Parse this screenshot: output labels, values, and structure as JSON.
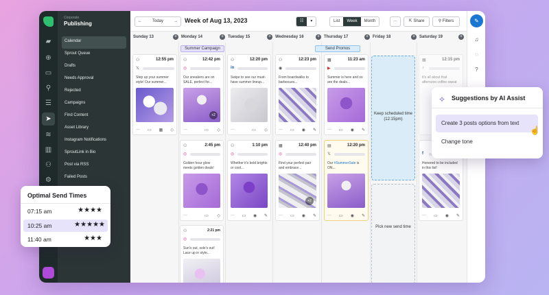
{
  "sidebar": {
    "org": "Corporate",
    "workspace": "Publishing",
    "items": [
      {
        "label": "Calendar",
        "active": true
      },
      {
        "label": "Sprout Queue"
      },
      {
        "label": "Drafts"
      },
      {
        "label": "Needs Approval"
      },
      {
        "label": "Rejected"
      },
      {
        "label": "Campaigns"
      },
      {
        "label": "Find Content"
      },
      {
        "label": "Asset Library"
      },
      {
        "label": "Instagram Notifications"
      },
      {
        "label": "SproutLink in Bio"
      },
      {
        "label": "Post via RSS"
      },
      {
        "label": "Failed Posts"
      }
    ]
  },
  "toolbar": {
    "today": "Today",
    "week_title": "Week of Aug 13, 2023",
    "views": [
      "List",
      "Week",
      "Month"
    ],
    "active_view": "Week",
    "more": "···",
    "share": "Share",
    "filters": "Filters"
  },
  "days": [
    "Sunday 13",
    "Monday 14",
    "Tuesday 15",
    "Wednesday 16",
    "Thursday 17",
    "Friday 18",
    "Saturday 19"
  ],
  "banners": {
    "summer": "Summer Campaign",
    "promos": "Send Promos"
  },
  "cards": {
    "sun1": {
      "time": "12:55 pm",
      "net": "𝕏",
      "text": "Step up your summer style! Our summer..."
    },
    "mon1": {
      "time": "12:42 pm",
      "net": "◎",
      "text": "Our sneakers are on SALE, perfect for...",
      "more": "+2"
    },
    "mon2": {
      "time": "2:45 pm",
      "net": "◎",
      "text": "Golden hour glow meets golden deals!"
    },
    "mon3": {
      "time": "2:21 pm",
      "net": "◎",
      "text": "Sun's out, sole's out! Lace up in style..."
    },
    "tue1": {
      "time": "12:20 pm",
      "net": "in",
      "text": "Swipe to see our must-have summer lineup..."
    },
    "tue2": {
      "time": "1:10 pm",
      "net": "◎",
      "text": "Whether it's bold brights or cool..."
    },
    "wed1": {
      "time": "12:23 pm",
      "net": "◉",
      "text": "From boardwalks to barbecues..."
    },
    "wed2": {
      "time": "12:40 pm",
      "net": "◎",
      "text": "Find your perfect pair and embrace...",
      "more": "+2"
    },
    "thu1": {
      "time": "11:23 am",
      "net": "▶",
      "text": "Summer is here and so are the deals..."
    },
    "thu2": {
      "time": "12:20 pm",
      "net": "𝕏",
      "text_pre": "Our ",
      "hashtag": "#SummerSale",
      "text_post": " is ON..."
    },
    "sat1": {
      "time": "12:15 pm",
      "net": "♪",
      "text": "It's all about that afternoon coffee sweat"
    },
    "sat2": {
      "time": "",
      "net": "f",
      "text": "Honored to be included in this list!"
    }
  },
  "drops": {
    "keep": "Keep scheduled time (12:15pm)",
    "pick": "Pick new send time"
  },
  "ai": {
    "title": "Suggestions by AI Assist",
    "option1": "Create 3 posts options from text",
    "option2": "Change tone"
  },
  "send_times": {
    "title": "Optimal Send Times",
    "rows": [
      {
        "time": "07:15 am",
        "stars": "★★★★",
        "highlight": false
      },
      {
        "time": "10:25 am",
        "stars": "★★★★★",
        "highlight": true
      },
      {
        "time": "11:40 am",
        "stars": "★★★",
        "highlight": false
      }
    ]
  },
  "colors": {
    "accent": "#1b76d1",
    "sidebar": "#2b3535",
    "rail": "#1f2a2a",
    "brand": "#2fbf6e",
    "highlight": "#e7e3fb"
  }
}
